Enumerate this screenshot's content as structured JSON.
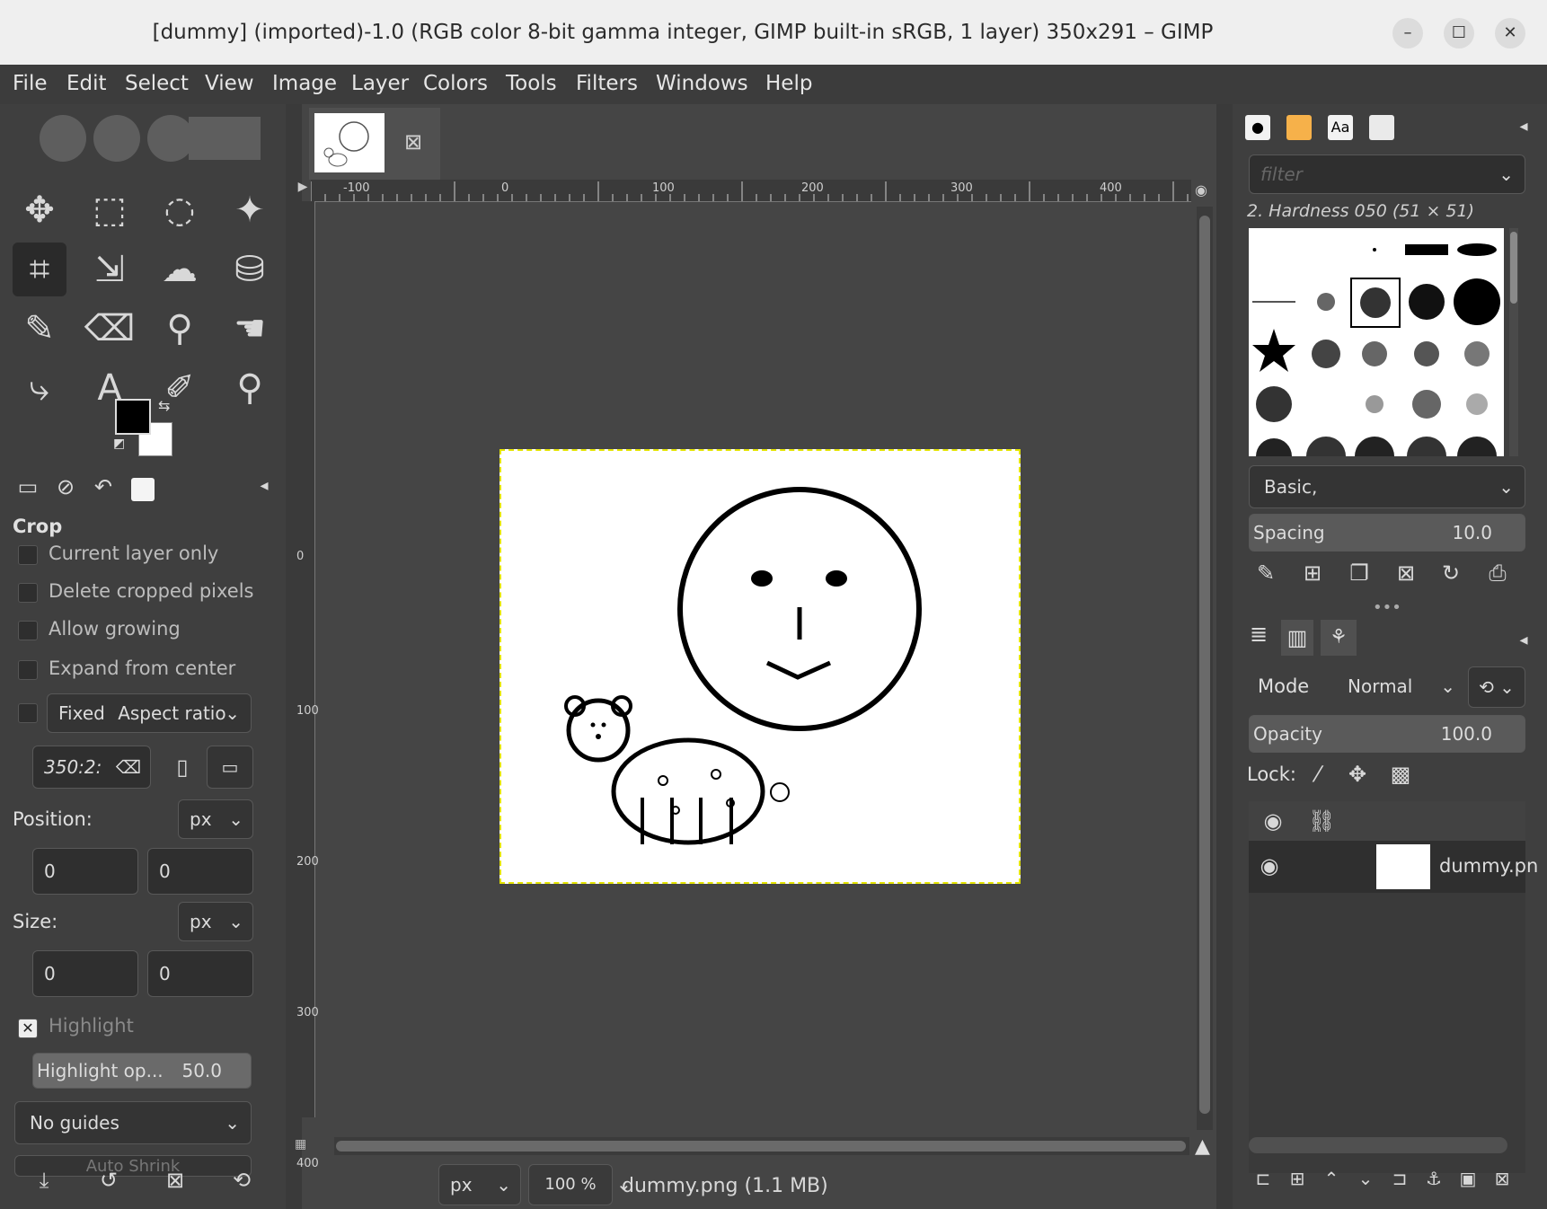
{
  "window": {
    "title": "[dummy] (imported)-1.0 (RGB color 8-bit gamma integer, GIMP built-in sRGB, 1 layer) 350x291 – GIMP",
    "minimize": "–",
    "maximize": "☐",
    "close": "✕"
  },
  "menu": [
    "File",
    "Edit",
    "Select",
    "View",
    "Image",
    "Layer",
    "Colors",
    "Tools",
    "Filters",
    "Windows",
    "Help"
  ],
  "tool_options": {
    "title": "Crop",
    "current_layer_only": "Current layer only",
    "delete_cropped_pixels": "Delete cropped pixels",
    "allow_growing": "Allow growing",
    "expand_from_center": "Expand from center",
    "fixed_label": "Fixed",
    "fixed_value": "Aspect ratio",
    "ratio_value": "350:2:",
    "position_label": "Position:",
    "position_unit": "px",
    "position_x": "0",
    "position_y": "0",
    "size_label": "Size:",
    "size_unit": "px",
    "size_w": "0",
    "size_h": "0",
    "highlight": "Highlight",
    "highlight_opacity_label": "Highlight op...",
    "highlight_opacity_value": "50.0",
    "guides": "No guides",
    "auto_shrink": "Auto Shrink"
  },
  "canvas": {
    "ruler_labels": [
      "-100",
      "0",
      "100",
      "200",
      "300",
      "400"
    ],
    "vruler_labels": [
      "0",
      "100",
      "200",
      "300",
      "400"
    ],
    "status_unit": "px",
    "zoom": "100 %",
    "status_file": "dummy.png (1.1 MB)"
  },
  "brushes": {
    "filter_placeholder": "filter",
    "selected_brush": "2. Hardness 050 (51 × 51)",
    "tag": "Basic,",
    "spacing_label": "Spacing",
    "spacing_value": "10.0"
  },
  "layers": {
    "mode_label": "Mode",
    "mode_value": "Normal",
    "opacity_label": "Opacity",
    "opacity_value": "100.0",
    "lock_label": "Lock:",
    "layer_name": "dummy.pn"
  }
}
